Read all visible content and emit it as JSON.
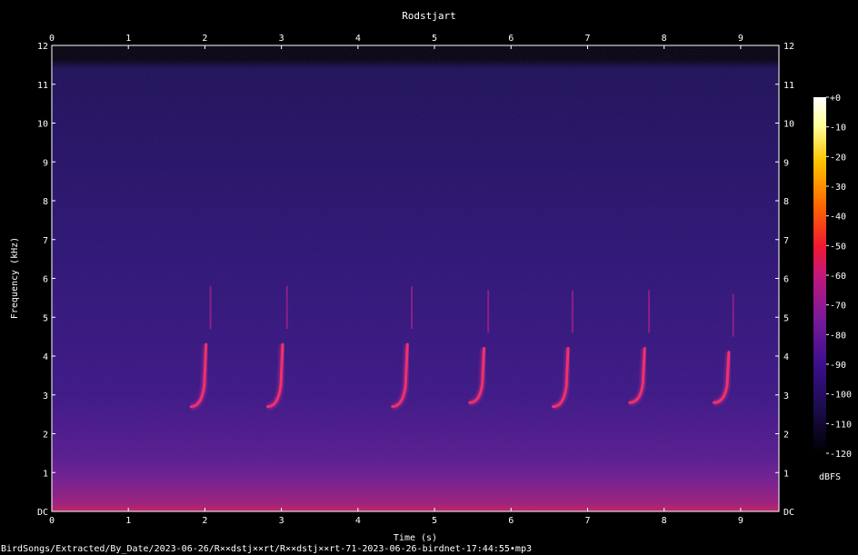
{
  "chart_data": {
    "type": "heatmap",
    "title": "Rodstjart",
    "xlabel": "Time (s)",
    "ylabel": "Frequency (kHz)",
    "xlim": [
      0,
      9.5
    ],
    "ylim": [
      0,
      12
    ],
    "x_ticks": [
      "0",
      "1",
      "2",
      "3",
      "4",
      "5",
      "6",
      "7",
      "8",
      "9"
    ],
    "y_ticks": [
      "DC",
      "1",
      "2",
      "3",
      "4",
      "5",
      "6",
      "7",
      "8",
      "9",
      "10",
      "11",
      "12"
    ],
    "colorbar": {
      "label": "dBFS",
      "ticks": [
        "+0",
        "-10",
        "-20",
        "-30",
        "-40",
        "-50",
        "-60",
        "-70",
        "-80",
        "-90",
        "-100",
        "-110",
        "-120"
      ],
      "range": [
        -120,
        0
      ],
      "colors": [
        "#000000",
        "#1a0b4a",
        "#3b0f8c",
        "#7a1a9a",
        "#c2187a",
        "#f01832",
        "#ff6a00",
        "#ffc400",
        "#ffff99",
        "#ffffff"
      ]
    },
    "calls": [
      {
        "t_start": 1.82,
        "t_end": 2.05,
        "f_low": 2.7,
        "f_high": 4.3
      },
      {
        "t_start": 2.82,
        "t_end": 3.05,
        "f_low": 2.7,
        "f_high": 4.3
      },
      {
        "t_start": 4.45,
        "t_end": 4.68,
        "f_low": 2.7,
        "f_high": 4.3
      },
      {
        "t_start": 5.46,
        "t_end": 5.68,
        "f_low": 2.8,
        "f_high": 4.2
      },
      {
        "t_start": 6.55,
        "t_end": 6.78,
        "f_low": 2.7,
        "f_high": 4.2
      },
      {
        "t_start": 7.55,
        "t_end": 7.78,
        "f_low": 2.8,
        "f_high": 4.2
      },
      {
        "t_start": 8.65,
        "t_end": 8.88,
        "f_low": 2.8,
        "f_high": 4.1
      }
    ]
  },
  "footer": "BirdSongs/Extracted/By_Date/2023-06-26/R××dstj××rt/R××dstj××rt-71-2023-06-26-birdnet-17:44:55•mp3"
}
